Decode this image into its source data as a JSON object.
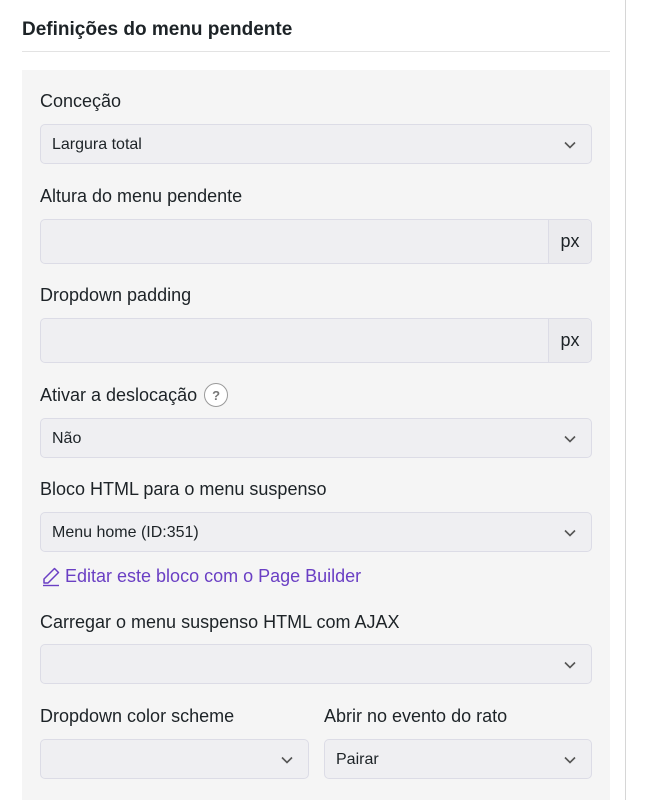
{
  "section": {
    "title": "Definições do menu pendente"
  },
  "fields": {
    "design": {
      "label": "Conceção",
      "value": "Largura total"
    },
    "height": {
      "label": "Altura do menu pendente",
      "value": "",
      "unit": "px"
    },
    "padding": {
      "label": "Dropdown padding",
      "value": "",
      "unit": "px"
    },
    "scroll": {
      "label": "Ativar a deslocação",
      "help": "?",
      "value": "Não"
    },
    "html_block": {
      "label": "Bloco HTML para o menu suspenso",
      "value": "Menu home (ID:351)"
    },
    "edit_link": {
      "label": "Editar este bloco com o Page Builder"
    },
    "ajax": {
      "label": "Carregar o menu suspenso HTML com AJAX",
      "value": ""
    },
    "color_scheme": {
      "label": "Dropdown color scheme",
      "value": ""
    },
    "mouse_event": {
      "label": "Abrir no evento do rato",
      "value": "Pairar"
    }
  },
  "colors": {
    "link": "#6a3fc4",
    "panel_bg": "#f5f5f5",
    "control_bg": "#efeff2",
    "control_border": "#dcdce6"
  },
  "icons": {
    "help": "question-circle-icon",
    "edit": "pencil-icon",
    "dropdown": "chevron-down-icon"
  }
}
